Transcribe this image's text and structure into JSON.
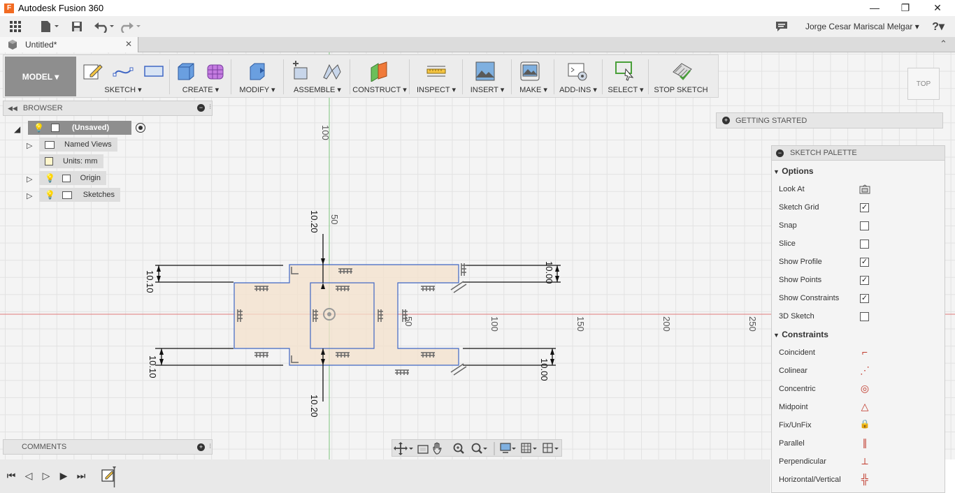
{
  "window": {
    "title": "Autodesk Fusion 360",
    "app_icon_letter": "F",
    "minimize": "—",
    "maximize": "❐",
    "close": "✕"
  },
  "appbar": {
    "user_name": "Jorge Cesar Mariscal Melgar ▾",
    "help": "?▾"
  },
  "tab": {
    "label": "Untitled*",
    "close": "✕"
  },
  "ribbon": {
    "workspace": "MODEL ▾",
    "groups": {
      "sketch": "SKETCH ▾",
      "create": "CREATE ▾",
      "modify": "MODIFY ▾",
      "assemble": "ASSEMBLE ▾",
      "construct": "CONSTRUCT ▾",
      "inspect": "INSPECT ▾",
      "insert": "INSERT ▾",
      "make": "MAKE ▾",
      "addins": "ADD-INS ▾",
      "select": "SELECT ▾",
      "stop_sketch": "STOP SKETCH"
    }
  },
  "viewcube": {
    "label": "TOP"
  },
  "browser": {
    "title": "BROWSER",
    "root": "(Unsaved)",
    "items": {
      "named_views": "Named Views",
      "units": "Units: mm",
      "origin": "Origin",
      "sketches": "Sketches"
    }
  },
  "getting_started": {
    "title": "GETTING STARTED"
  },
  "palette": {
    "title": "SKETCH PALETTE",
    "options_header": "Options",
    "options": [
      {
        "label": "Look At",
        "type": "button"
      },
      {
        "label": "Sketch Grid",
        "checked": true
      },
      {
        "label": "Snap",
        "checked": false
      },
      {
        "label": "Slice",
        "checked": false
      },
      {
        "label": "Show Profile",
        "checked": true
      },
      {
        "label": "Show Points",
        "checked": true
      },
      {
        "label": "Show Constraints",
        "checked": true
      },
      {
        "label": "3D Sketch",
        "checked": false
      }
    ],
    "constraints_header": "Constraints",
    "constraints": [
      {
        "label": "Coincident",
        "glyph": "⌐"
      },
      {
        "label": "Colinear",
        "glyph": "⋰"
      },
      {
        "label": "Concentric",
        "glyph": "◎"
      },
      {
        "label": "Midpoint",
        "glyph": "△"
      },
      {
        "label": "Fix/UnFix",
        "glyph": "🔒"
      },
      {
        "label": "Parallel",
        "glyph": "∥"
      },
      {
        "label": "Perpendicular",
        "glyph": "⟂"
      },
      {
        "label": "Horizontal/Vertical",
        "glyph": "╬"
      }
    ]
  },
  "comments": {
    "title": "COMMENTS"
  },
  "canvas": {
    "axis_labels_vertical": [
      "100",
      "50"
    ],
    "axis_labels_horizontal": [
      "50",
      "100",
      "150",
      "200",
      "250"
    ],
    "dimensions": [
      "10.20",
      "10.10",
      "10.00",
      "10.10",
      "10.00",
      "10.20"
    ]
  },
  "colors": {
    "accent": "#f26b22",
    "sketch_line": "#3f66c4",
    "profile_fill": "#f4e1cc",
    "x_axis": "#e07a7a",
    "y_axis": "#7cc47c"
  }
}
